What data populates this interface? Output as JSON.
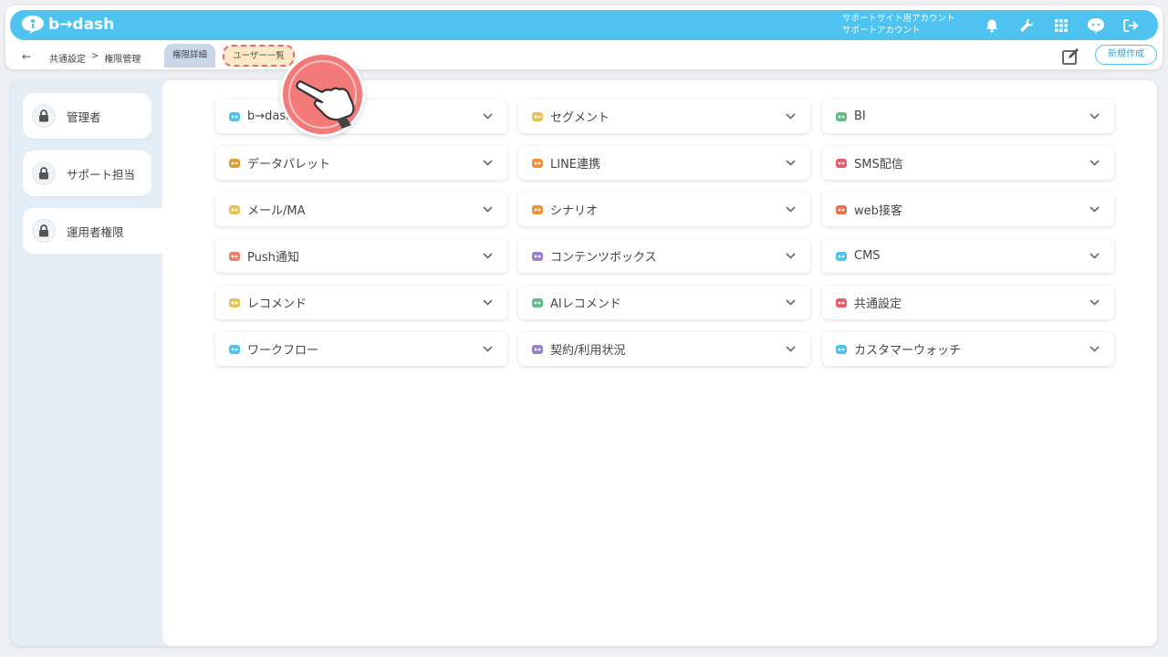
{
  "header": {
    "logo_text": "b→dash",
    "account_line1": "サポートサイト用アカウント",
    "account_line2": "サポートアカウント",
    "icons": [
      "bell-icon",
      "wrench-icon",
      "grid-icon",
      "chat-bot-icon",
      "logout-icon"
    ],
    "brand_color": "#4ec3ef"
  },
  "subbar": {
    "breadcrumb": [
      "共通設定",
      ">",
      "権限管理"
    ],
    "tabs": [
      {
        "label": "権限詳細",
        "active": true
      },
      {
        "label": "ユーザー一覧",
        "highlighted": true
      }
    ],
    "new_button": "新規作成"
  },
  "sidebar": {
    "items": [
      {
        "label": "管理者"
      },
      {
        "label": "サポート担当"
      },
      {
        "label": "運用者権限",
        "active": true
      }
    ]
  },
  "accordions": [
    {
      "label": "b→dash",
      "icon": "bdash-icon",
      "color": "#4ec3ef"
    },
    {
      "label": "セグメント",
      "icon": "segment-icon",
      "color": "#e8c35a"
    },
    {
      "label": "BI",
      "icon": "bi-chart-icon",
      "color": "#5fbf86"
    },
    {
      "label": "データパレット",
      "icon": "palette-icon",
      "color": "#e39a3a"
    },
    {
      "label": "LINE連携",
      "icon": "line-icon",
      "color": "#ef8f3a"
    },
    {
      "label": "SMS配信",
      "icon": "sms-icon",
      "color": "#e85a6a"
    },
    {
      "label": "メール/MA",
      "icon": "mail-icon",
      "color": "#e8c35a"
    },
    {
      "label": "シナリオ",
      "icon": "scenario-icon",
      "color": "#e8933a"
    },
    {
      "label": "web接客",
      "icon": "web-icon",
      "color": "#e8734a"
    },
    {
      "label": "Push通知",
      "icon": "push-icon",
      "color": "#ef7f6a"
    },
    {
      "label": "コンテンツボックス",
      "icon": "content-box-icon",
      "color": "#9b7fd0"
    },
    {
      "label": "CMS",
      "icon": "cms-icon",
      "color": "#4ec3ef"
    },
    {
      "label": "レコメンド",
      "icon": "recommend-icon",
      "color": "#e8c35a"
    },
    {
      "label": "AIレコメンド",
      "icon": "ai-recommend-icon",
      "color": "#5fbf86"
    },
    {
      "label": "共通設定",
      "icon": "common-settings-icon",
      "color": "#e85a6a"
    },
    {
      "label": "ワークフロー",
      "icon": "workflow-icon",
      "color": "#4ec3ef"
    },
    {
      "label": "契約/利用状況",
      "icon": "contract-icon",
      "color": "#9b7fd0"
    },
    {
      "label": "カスタマーウォッチ",
      "icon": "customer-watch-icon",
      "color": "#4ec3ef"
    }
  ]
}
